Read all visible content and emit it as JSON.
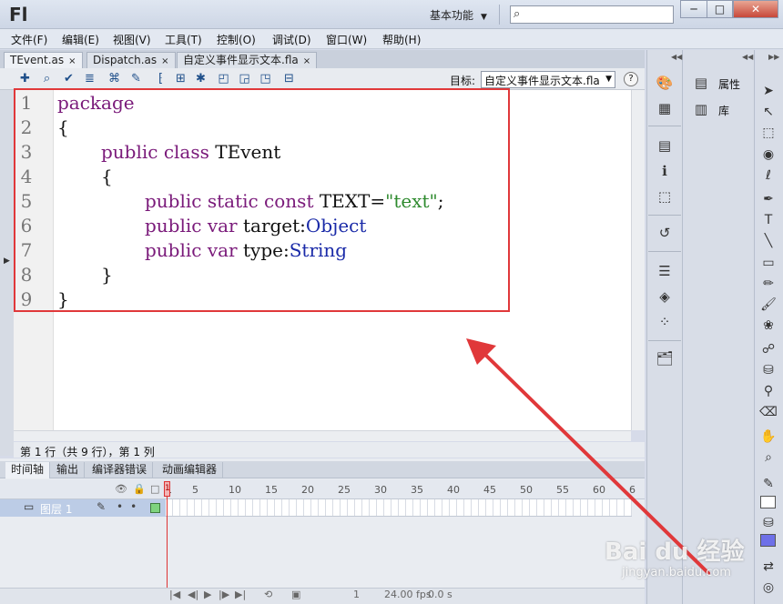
{
  "app": {
    "logo": "Fl",
    "workspace": "基本功能",
    "window_buttons": [
      "─",
      "□",
      "✕"
    ]
  },
  "menus": [
    "文件(F)",
    "编辑(E)",
    "视图(V)",
    "工具(T)",
    "控制(O)",
    "调试(D)",
    "窗口(W)",
    "帮助(H)"
  ],
  "tabs": [
    {
      "label": "TEvent.as",
      "close": "×",
      "active": true
    },
    {
      "label": "Dispatch.as",
      "close": "×",
      "active": false
    },
    {
      "label": "自定义事件显示文本.fla",
      "close": "×",
      "active": false
    }
  ],
  "toolbar": {
    "icons": [
      "add-script-item-icon",
      "find-icon",
      "check-syntax-icon",
      "auto-format-icon",
      "code-hint-icon",
      "debug-options-icon",
      "collapse-braces-icon",
      "collapse-selection-icon",
      "expand-all-icon",
      "apply-block-comment-icon",
      "apply-line-comment-icon",
      "remove-comment-icon",
      "show-hide-toolbox-icon"
    ],
    "target_label": "目标:",
    "target_value": "自定义事件显示文本.fla",
    "help": "?"
  },
  "editor": {
    "lines": [
      {
        "n": "1",
        "indent": 0,
        "tokens": [
          {
            "t": "package",
            "c": "kw"
          }
        ]
      },
      {
        "n": "2",
        "indent": 0,
        "tokens": [
          {
            "t": "{",
            "c": ""
          }
        ]
      },
      {
        "n": "3",
        "indent": 1,
        "tokens": [
          {
            "t": "public class ",
            "c": "kw"
          },
          {
            "t": "TEvent",
            "c": ""
          }
        ]
      },
      {
        "n": "4",
        "indent": 1,
        "tokens": [
          {
            "t": "{",
            "c": ""
          }
        ]
      },
      {
        "n": "5",
        "indent": 2,
        "tokens": [
          {
            "t": "public static const ",
            "c": "kw"
          },
          {
            "t": "TEXT=",
            "c": ""
          },
          {
            "t": "\"text\"",
            "c": "str"
          },
          {
            "t": ";",
            "c": ""
          }
        ]
      },
      {
        "n": "6",
        "indent": 2,
        "tokens": [
          {
            "t": "public var ",
            "c": "kw"
          },
          {
            "t": "target:",
            "c": ""
          },
          {
            "t": "Object",
            "c": "ty"
          }
        ]
      },
      {
        "n": "7",
        "indent": 2,
        "tokens": [
          {
            "t": "public var ",
            "c": "kw"
          },
          {
            "t": "type:",
            "c": ""
          },
          {
            "t": "String",
            "c": "ty"
          }
        ]
      },
      {
        "n": "8",
        "indent": 1,
        "tokens": [
          {
            "t": "}",
            "c": ""
          }
        ]
      },
      {
        "n": "9",
        "indent": 0,
        "tokens": [
          {
            "t": "}",
            "c": ""
          }
        ]
      }
    ],
    "status": "第 1 行（共 9 行），第 1 列"
  },
  "timeline": {
    "tabs": [
      "时间轴",
      "输出",
      "编译器错误",
      "动画编辑器"
    ],
    "frame_numbers": [
      "1",
      "5",
      "10",
      "15",
      "20",
      "25",
      "30",
      "35",
      "40",
      "45",
      "50",
      "55",
      "60",
      "6"
    ],
    "layer_name": "图层 1",
    "fps": "24.00 fps",
    "time": "0.0 s",
    "current_frame": "1"
  },
  "panels": {
    "properties_label": "属性",
    "library_label": "库"
  },
  "watermark": {
    "logo": "Bai du 经验",
    "url": "jingyan.baidu.com"
  },
  "colors": {
    "highlight_border": "#e0383a",
    "keyword": "#7a1a7a",
    "type": "#1a2aa8",
    "string": "#2e8a2e",
    "fill_color": "#6e70e8"
  }
}
